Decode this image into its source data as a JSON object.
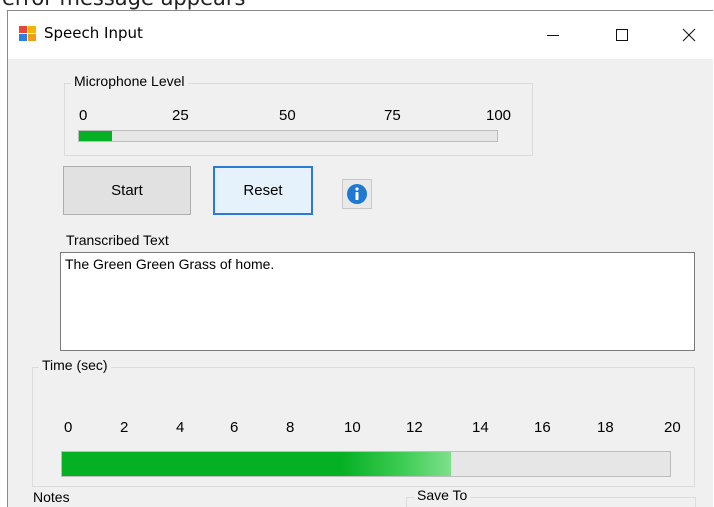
{
  "background_caption": "error message appears",
  "window": {
    "title": "Speech Input",
    "controls": {
      "minimize": "minimize",
      "maximize": "maximize",
      "close": "close"
    }
  },
  "mic_level": {
    "group_label": "Microphone Level",
    "ticks": [
      "0",
      "25",
      "50",
      "75",
      "100"
    ],
    "level_fraction": 0.08,
    "fill_color": "#06b025"
  },
  "buttons": {
    "start_label": "Start",
    "reset_label": "Reset",
    "info_icon": "info-icon"
  },
  "transcript": {
    "label": "Transcribed Text",
    "value": "The Green Green Grass of home."
  },
  "time": {
    "group_label": "Time (sec)",
    "ticks": [
      "0",
      "2",
      "4",
      "6",
      "8",
      "10",
      "12",
      "14",
      "16",
      "18",
      "20"
    ],
    "progress_fraction": 0.64,
    "fill_color": "#06b025"
  },
  "notes": {
    "label": "Notes"
  },
  "save_to": {
    "group_label": "Save To"
  },
  "colors": {
    "accent": "#2b7ad6",
    "progress_green": "#06b025",
    "info_blue": "#1e78d4"
  }
}
